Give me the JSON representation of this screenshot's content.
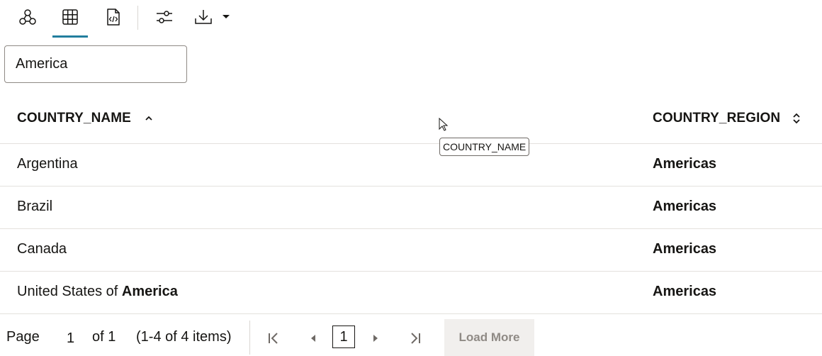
{
  "search": {
    "value": "America"
  },
  "table": {
    "columns": [
      {
        "label": "COUNTRY_NAME",
        "sort": "ascending"
      },
      {
        "label": "COUNTRY_REGION",
        "sort": "none"
      }
    ],
    "rows": [
      {
        "name_pre": "Argentina",
        "name_match": "",
        "region": "Americas"
      },
      {
        "name_pre": "Brazil",
        "name_match": "",
        "region": "Americas"
      },
      {
        "name_pre": "Canada",
        "name_match": "",
        "region": "Americas"
      },
      {
        "name_pre": "United States of ",
        "name_match": "America",
        "region": "Americas"
      }
    ]
  },
  "tooltip": {
    "text": "COUNTRY_NAME"
  },
  "pagination": {
    "page_label": "Page",
    "page_value": "1",
    "of_label": "of 1",
    "range_label": "(1-4 of 4 items)",
    "current_page": "1",
    "load_more_label": "Load More"
  },
  "toolbar": {
    "icons": [
      "graph-view-icon",
      "table-view-icon",
      "code-view-icon",
      "settings-sliders-icon",
      "download-icon",
      "caret-down-icon"
    ],
    "active_tab": "table-view"
  },
  "colors": {
    "accent": "#227e9e",
    "text": "#161513",
    "border": "#e4e1dd",
    "disabled_bg": "#f1efed",
    "disabled_text": "#8f8a85"
  }
}
